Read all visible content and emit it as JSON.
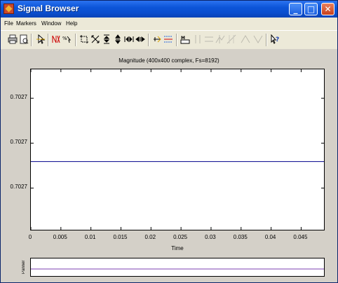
{
  "window": {
    "title": "Signal Browser"
  },
  "menu": [
    "File",
    "Markers",
    "Window",
    "Help"
  ],
  "toolbar": {
    "icons": [
      "print-icon",
      "print-preview-icon",
      "pointer-select-icon",
      "array-signals-icon",
      "select-trace-icon",
      "zoom-box-icon",
      "fit-all-icon",
      "zoom-y-out-icon",
      "zoom-y-in-icon",
      "zoom-x-out-icon",
      "zoom-x-in-icon",
      "marker-pointer-icon",
      "marker-settings-icon",
      "marker-table-icon",
      "vertical-markers-icon",
      "horizontal-markers-icon",
      "track-markers-icon",
      "slope-markers-icon",
      "peaks-icon",
      "valleys-icon",
      "whats-this-help-icon"
    ]
  },
  "plot": {
    "title": "Magnitude (400x400 complex, Fs=8192)",
    "xlabel": "Time",
    "panner_label": "Panner"
  },
  "chart_data": {
    "type": "line",
    "title": "Magnitude (400x400 complex, Fs=8192)",
    "xlabel": "Time",
    "ylabel": "",
    "x_ticks": [
      0,
      0.005,
      0.01,
      0.015,
      0.02,
      0.025,
      0.03,
      0.035,
      0.04,
      0.045
    ],
    "x_tick_labels": [
      "0",
      "0.005",
      "0.01",
      "0.015",
      "0.02",
      "0.025",
      "0.03",
      "0.035",
      "0.04",
      "0.045"
    ],
    "xlim": [
      0,
      0.0488
    ],
    "y_tick_labels": [
      "0.7027",
      "0.7027",
      "0.7027"
    ],
    "series": [
      {
        "x": [
          0,
          0.0488
        ],
        "y": [
          0.7027,
          0.7027
        ],
        "color": "#00008b"
      }
    ],
    "grid": false
  },
  "colors": {
    "line": "#00008b",
    "titlebar": "#0c55d8",
    "panner_line": "#7b3fb0"
  }
}
